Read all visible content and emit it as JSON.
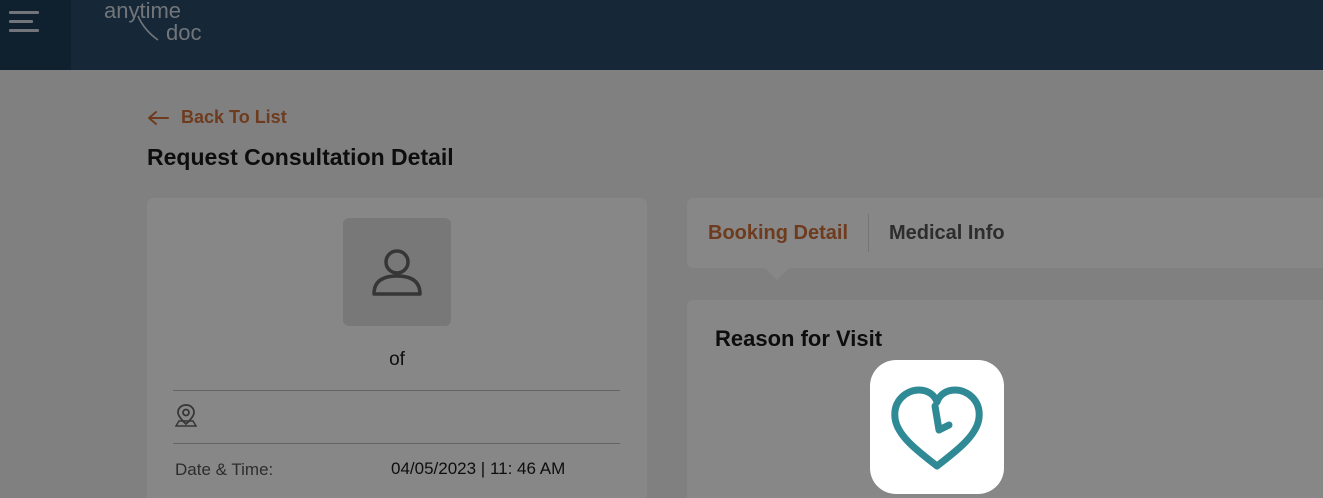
{
  "header": {
    "menu_icon": "hamburger-menu-icon",
    "logo_text_top": "anytime",
    "logo_text_bottom": "doc",
    "brand_color": "#2a4a68"
  },
  "navigation": {
    "back_label": "Back To List",
    "back_icon": "arrow-left-icon"
  },
  "page": {
    "title": "Request Consultation Detail"
  },
  "patient_card": {
    "avatar_icon": "user-avatar-icon",
    "name_text": "of",
    "location_icon": "map-pin-icon",
    "datetime_label": "Date & Time:",
    "datetime_value": "04/05/2023 | 11: 46 AM"
  },
  "tabs": [
    {
      "label": "Booking Detail",
      "active": true
    },
    {
      "label": "Medical Info",
      "active": false
    }
  ],
  "booking_detail": {
    "reason_title": "Reason for Visit"
  },
  "loader": {
    "icon": "heart-clock-logo-icon",
    "color": "#2f8a96"
  },
  "colors": {
    "accent": "#d0703a",
    "overlay": "rgba(0,0,0,0.47)"
  }
}
